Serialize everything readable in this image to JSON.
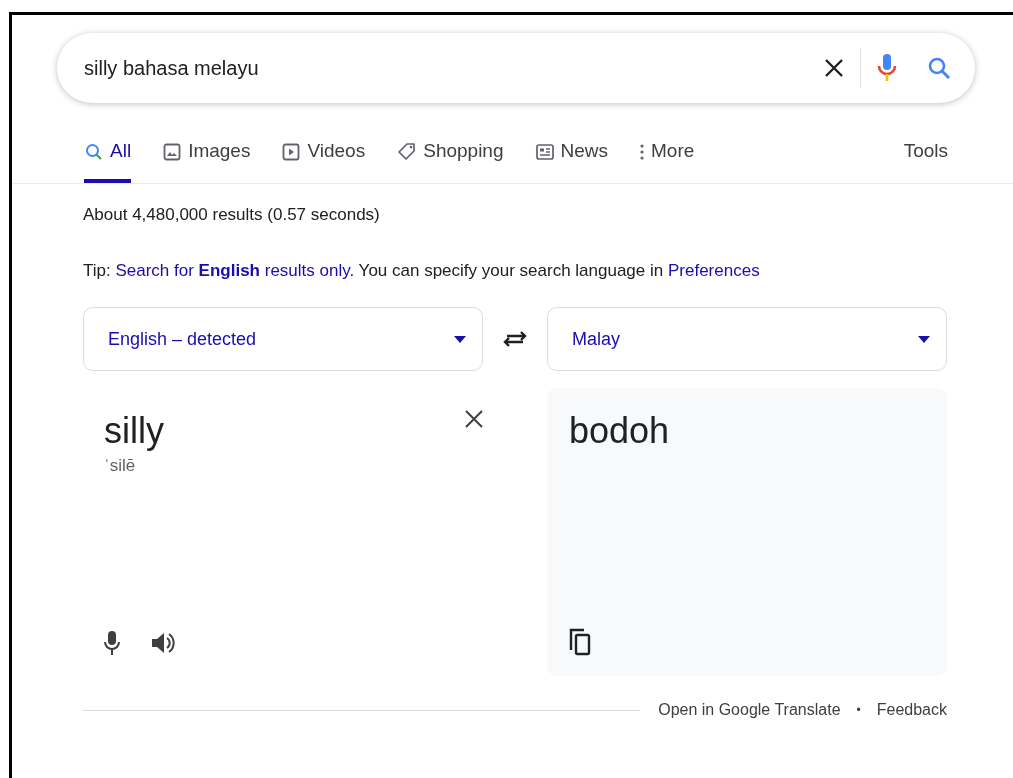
{
  "search": {
    "value": "silly bahasa melayu"
  },
  "tabs": [
    {
      "label": "All",
      "selected": true
    },
    {
      "label": "Images",
      "selected": false
    },
    {
      "label": "Videos",
      "selected": false
    },
    {
      "label": "Shopping",
      "selected": false
    },
    {
      "label": "News",
      "selected": false
    },
    {
      "label": "More",
      "selected": false
    }
  ],
  "tools": "Tools",
  "result_stats": "About 4,480,000 results (0.57 seconds)",
  "tip": {
    "prefix": "Tip:",
    "link": "Search for **English** results only",
    "middle": ". You can specify your search language in",
    "link2": "Preferences"
  },
  "translator": {
    "source_language": "English – detected",
    "target_language": "Malay",
    "source_text": "silly",
    "pronunciation": "ˈsilē",
    "translation": "bodoh"
  },
  "footer": {
    "open_link": "Open in Google Translate",
    "separator": "•",
    "feedback": "Feedback"
  }
}
